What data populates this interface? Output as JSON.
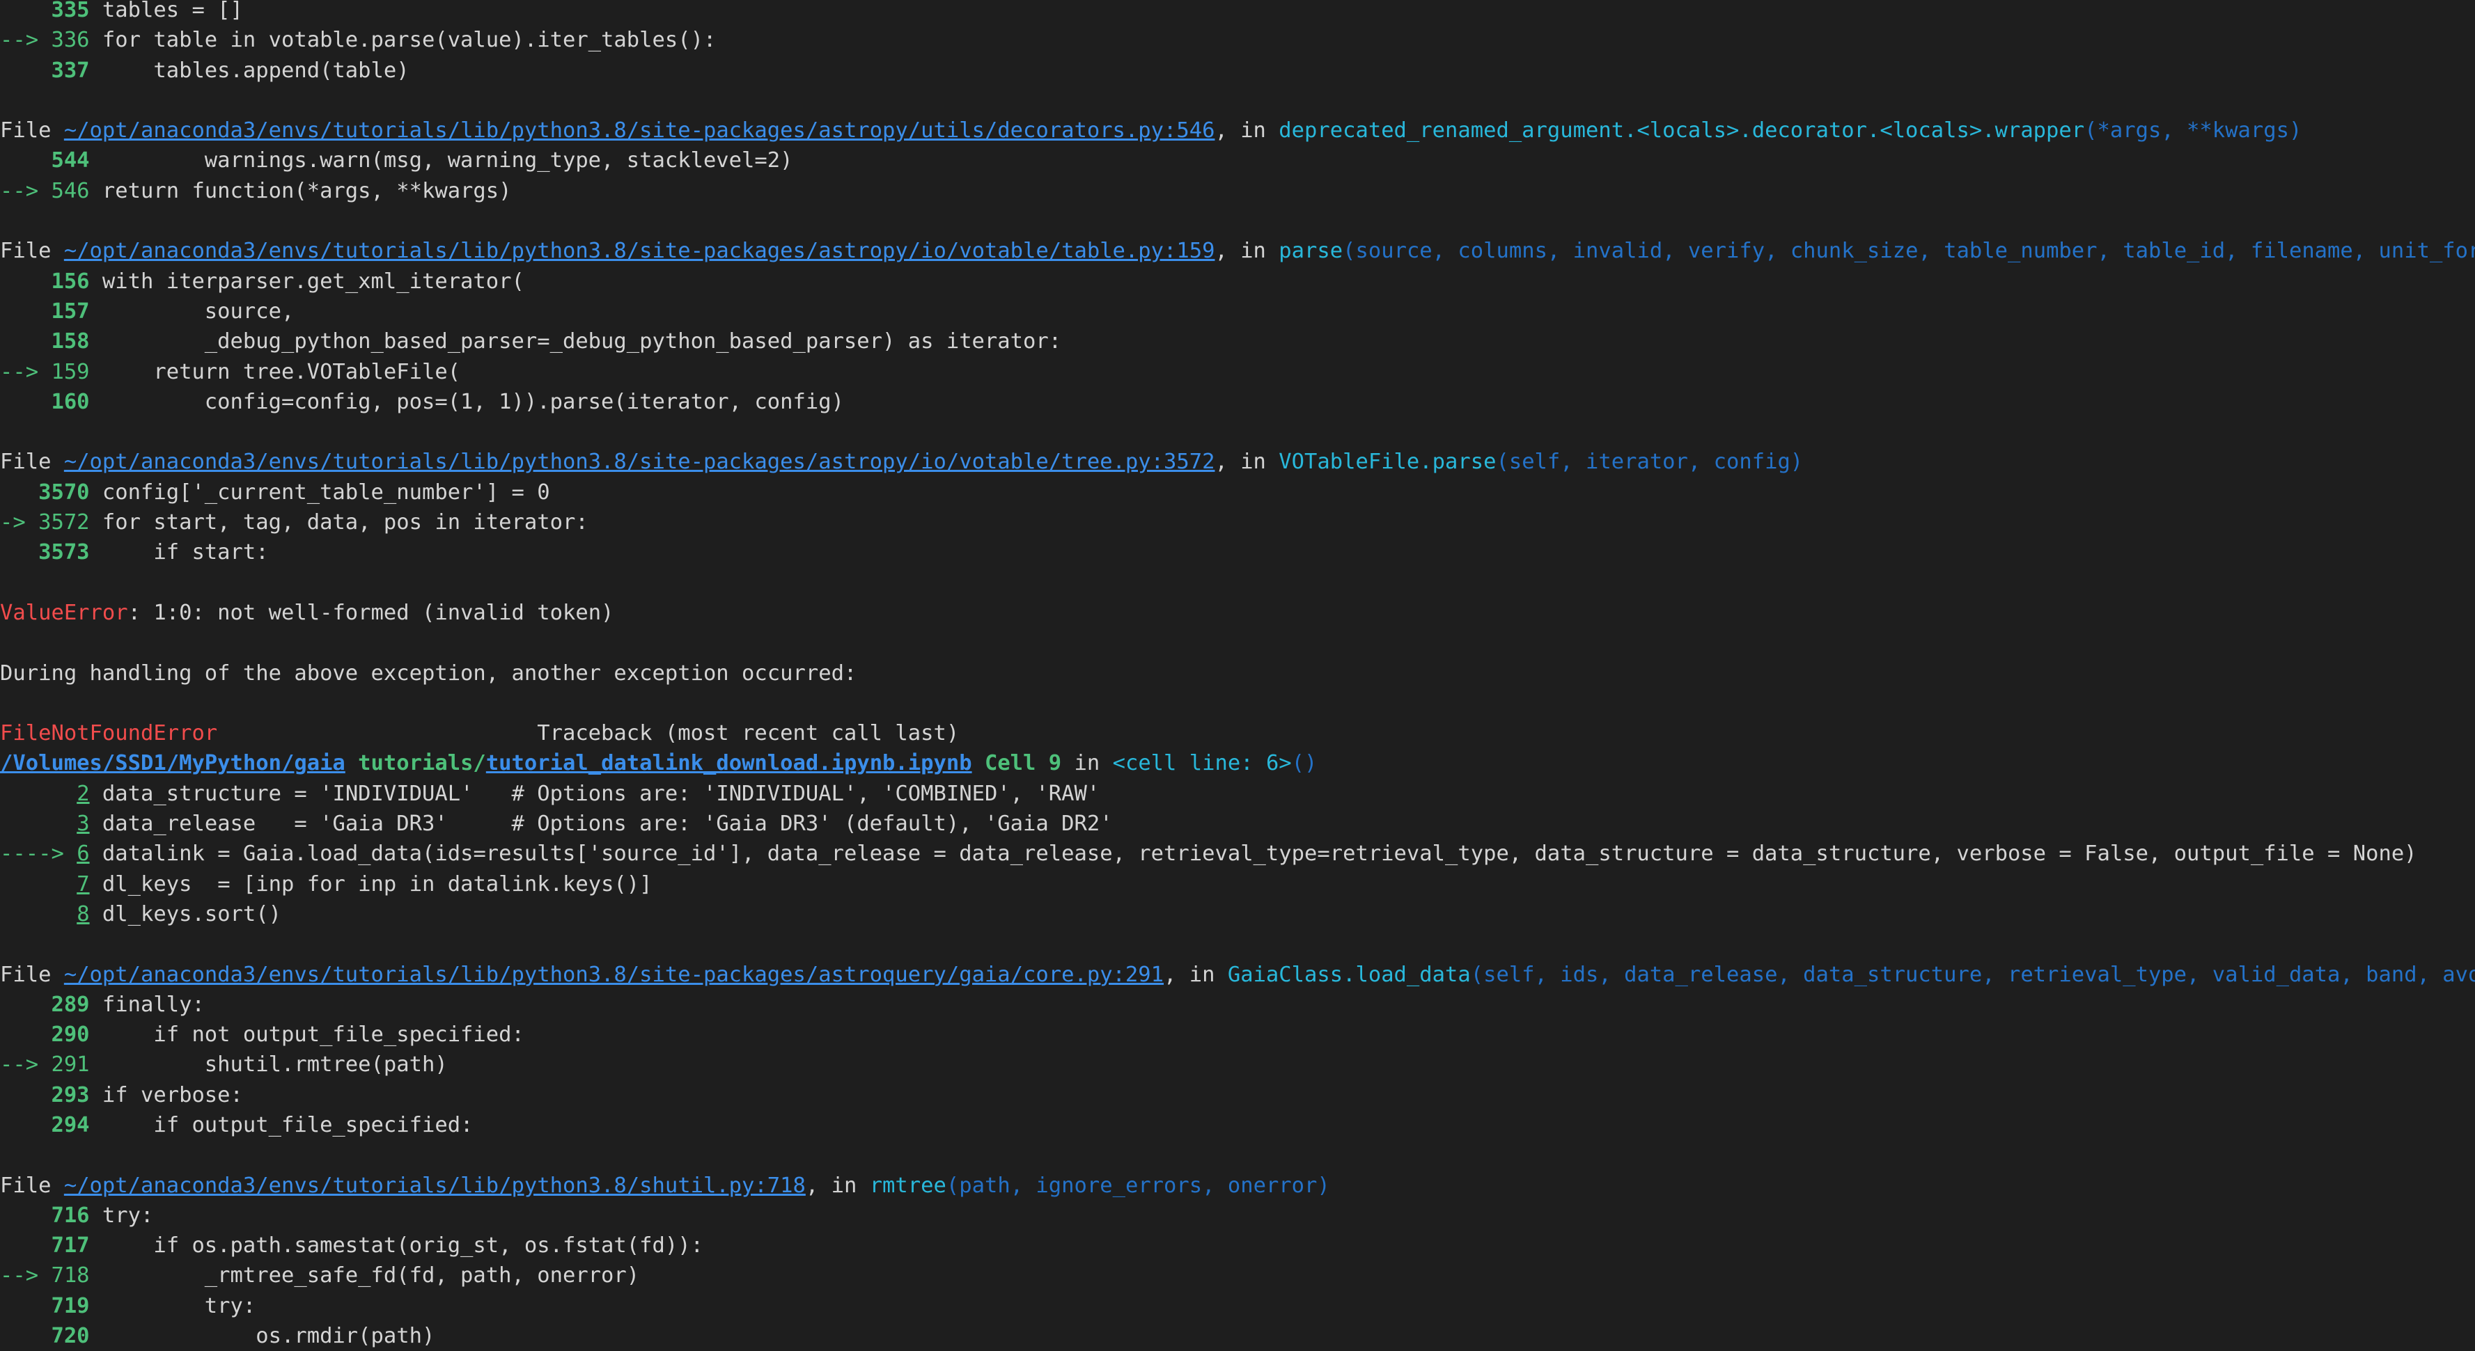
{
  "traceback": {
    "lines": [
      {
        "parts": [
          {
            "t": "    335 ",
            "s": "gb"
          },
          {
            "t": "tables = []"
          }
        ]
      },
      {
        "parts": [
          {
            "t": "--> 336 ",
            "s": "g"
          },
          {
            "t": "for table in votable.parse(value).iter_tables():"
          }
        ]
      },
      {
        "parts": [
          {
            "t": "    337 ",
            "s": "gb"
          },
          {
            "t": "    tables.append(table)"
          }
        ]
      },
      {
        "parts": [
          {
            "t": ""
          }
        ]
      },
      {
        "parts": [
          {
            "t": "File "
          },
          {
            "t": "~/opt/anaconda3/envs/tutorials/lib/python3.8/site-packages/astropy/utils/decorators.py:546",
            "s": "lk",
            "n": "file-link"
          },
          {
            "t": ", in "
          },
          {
            "t": "deprecated_renamed_argument.<locals>.decorator.<locals>.wrapper",
            "s": "c"
          },
          {
            "t": "(*args, **kwargs)",
            "s": "cl"
          }
        ]
      },
      {
        "parts": [
          {
            "t": "    544 ",
            "s": "gb"
          },
          {
            "t": "        warnings.warn(msg, warning_type, stacklevel=2)"
          }
        ]
      },
      {
        "parts": [
          {
            "t": "--> 546 ",
            "s": "g"
          },
          {
            "t": "return function(*args, **kwargs)"
          }
        ]
      },
      {
        "parts": [
          {
            "t": ""
          }
        ]
      },
      {
        "parts": [
          {
            "t": "File "
          },
          {
            "t": "~/opt/anaconda3/envs/tutorials/lib/python3.8/site-packages/astropy/io/votable/table.py:159",
            "s": "lk",
            "n": "file-link"
          },
          {
            "t": ", in "
          },
          {
            "t": "parse",
            "s": "c"
          },
          {
            "t": "(source, columns, invalid, verify, chunk_size, table_number, table_id, filename, unit_format, datatype_mapping, _debug_python_based_parser)",
            "s": "cl"
          }
        ]
      },
      {
        "parts": [
          {
            "t": "    156 ",
            "s": "gb"
          },
          {
            "t": "with iterparser.get_xml_iterator("
          }
        ]
      },
      {
        "parts": [
          {
            "t": "    157 ",
            "s": "gb"
          },
          {
            "t": "        source,"
          }
        ]
      },
      {
        "parts": [
          {
            "t": "    158 ",
            "s": "gb"
          },
          {
            "t": "        _debug_python_based_parser=_debug_python_based_parser) as iterator:"
          }
        ]
      },
      {
        "parts": [
          {
            "t": "--> 159 ",
            "s": "g"
          },
          {
            "t": "    return tree.VOTableFile("
          }
        ]
      },
      {
        "parts": [
          {
            "t": "    160 ",
            "s": "gb"
          },
          {
            "t": "        config=config, pos=(1, 1)).parse(iterator, config)"
          }
        ]
      },
      {
        "parts": [
          {
            "t": ""
          }
        ]
      },
      {
        "parts": [
          {
            "t": "File "
          },
          {
            "t": "~/opt/anaconda3/envs/tutorials/lib/python3.8/site-packages/astropy/io/votable/tree.py:3572",
            "s": "lk",
            "n": "file-link"
          },
          {
            "t": ", in "
          },
          {
            "t": "VOTableFile.parse",
            "s": "c"
          },
          {
            "t": "(self, iterator, config)",
            "s": "cl"
          }
        ]
      },
      {
        "parts": [
          {
            "t": "   3570 ",
            "s": "gb"
          },
          {
            "t": "config['_current_table_number'] = 0"
          }
        ]
      },
      {
        "parts": [
          {
            "t": "-> 3572 ",
            "s": "g"
          },
          {
            "t": "for start, tag, data, pos in iterator:"
          }
        ]
      },
      {
        "parts": [
          {
            "t": "   3573 ",
            "s": "gb"
          },
          {
            "t": "    if start:"
          }
        ]
      },
      {
        "parts": [
          {
            "t": ""
          }
        ]
      },
      {
        "parts": [
          {
            "t": "ValueError",
            "s": "r"
          },
          {
            "t": ": 1:0: not well-formed (invalid token)"
          }
        ]
      },
      {
        "parts": [
          {
            "t": ""
          }
        ]
      },
      {
        "parts": [
          {
            "t": "During handling of the above exception, another exception occurred:"
          }
        ]
      },
      {
        "parts": [
          {
            "t": ""
          }
        ]
      },
      {
        "parts": [
          {
            "t": "FileNotFoundError",
            "s": "r"
          },
          {
            "t": "                         Traceback (most recent call last)"
          }
        ]
      },
      {
        "parts": [
          {
            "t": "/Volumes/SSD1/MyPython/gaia",
            "s": "lkb",
            "n": "file-link"
          },
          {
            "t": " "
          },
          {
            "t": "tutorials/",
            "s": "gb"
          },
          {
            "t": "tutorial_datalink_download.ipynb.ipynb",
            "s": "lkb",
            "n": "file-link"
          },
          {
            "t": " Cell 9",
            "s": "gb"
          },
          {
            "t": " in "
          },
          {
            "t": "<cell line: 6>",
            "s": "c"
          },
          {
            "t": "()",
            "s": "cl"
          }
        ]
      },
      {
        "parts": [
          {
            "t": "      "
          },
          {
            "t": "2",
            "s": "lkg",
            "n": "line-link"
          },
          {
            "t": " data_structure = 'INDIVIDUAL'   # Options are: 'INDIVIDUAL', 'COMBINED', 'RAW'"
          }
        ]
      },
      {
        "parts": [
          {
            "t": "      "
          },
          {
            "t": "3",
            "s": "lkg",
            "n": "line-link"
          },
          {
            "t": " data_release   = 'Gaia DR3'     # Options are: 'Gaia DR3' (default), 'Gaia DR2'"
          }
        ]
      },
      {
        "parts": [
          {
            "t": "----> ",
            "s": "g"
          },
          {
            "t": "6",
            "s": "lkg",
            "n": "line-link"
          },
          {
            "t": " datalink = Gaia.load_data(ids=results['source_id'], data_release = data_release, retrieval_type=retrieval_type, data_structure = data_structure, verbose = False, output_file = None)"
          }
        ]
      },
      {
        "parts": [
          {
            "t": "      "
          },
          {
            "t": "7",
            "s": "lkg",
            "n": "line-link"
          },
          {
            "t": " dl_keys  = [inp for inp in datalink.keys()]"
          }
        ]
      },
      {
        "parts": [
          {
            "t": "      "
          },
          {
            "t": "8",
            "s": "lkg",
            "n": "line-link"
          },
          {
            "t": " dl_keys.sort()"
          }
        ]
      },
      {
        "parts": [
          {
            "t": ""
          }
        ]
      },
      {
        "parts": [
          {
            "t": "File "
          },
          {
            "t": "~/opt/anaconda3/envs/tutorials/lib/python3.8/site-packages/astroquery/gaia/core.py:291",
            "s": "lk",
            "n": "file-link"
          },
          {
            "t": ", in "
          },
          {
            "t": "GaiaClass.load_data",
            "s": "c"
          },
          {
            "t": "(self, ids, data_release, data_structure, retrieval_type, valid_data, band, avoid_datatype_check, format, output_file, overwrite_output_file, verbose)",
            "s": "cl"
          }
        ]
      },
      {
        "parts": [
          {
            "t": "    289 ",
            "s": "gb"
          },
          {
            "t": "finally:"
          }
        ]
      },
      {
        "parts": [
          {
            "t": "    290 ",
            "s": "gb"
          },
          {
            "t": "    if not output_file_specified:"
          }
        ]
      },
      {
        "parts": [
          {
            "t": "--> 291 ",
            "s": "g"
          },
          {
            "t": "        shutil.rmtree(path)"
          }
        ]
      },
      {
        "parts": [
          {
            "t": "    293 ",
            "s": "gb"
          },
          {
            "t": "if verbose:"
          }
        ]
      },
      {
        "parts": [
          {
            "t": "    294 ",
            "s": "gb"
          },
          {
            "t": "    if output_file_specified:"
          }
        ]
      },
      {
        "parts": [
          {
            "t": ""
          }
        ]
      },
      {
        "parts": [
          {
            "t": "File "
          },
          {
            "t": "~/opt/anaconda3/envs/tutorials/lib/python3.8/shutil.py:718",
            "s": "lk",
            "n": "file-link"
          },
          {
            "t": ", in "
          },
          {
            "t": "rmtree",
            "s": "c"
          },
          {
            "t": "(path, ignore_errors, onerror)",
            "s": "cl"
          }
        ]
      },
      {
        "parts": [
          {
            "t": "    716 ",
            "s": "gb"
          },
          {
            "t": "try:"
          }
        ]
      },
      {
        "parts": [
          {
            "t": "    717 ",
            "s": "gb"
          },
          {
            "t": "    if os.path.samestat(orig_st, os.fstat(fd)):"
          }
        ]
      },
      {
        "parts": [
          {
            "t": "--> 718 ",
            "s": "g"
          },
          {
            "t": "        _rmtree_safe_fd(fd, path, onerror)"
          }
        ]
      },
      {
        "parts": [
          {
            "t": "    719 ",
            "s": "gb"
          },
          {
            "t": "        try:"
          }
        ]
      },
      {
        "parts": [
          {
            "t": "    720 ",
            "s": "gb"
          },
          {
            "t": "            os.rmdir(path)"
          }
        ]
      }
    ]
  }
}
